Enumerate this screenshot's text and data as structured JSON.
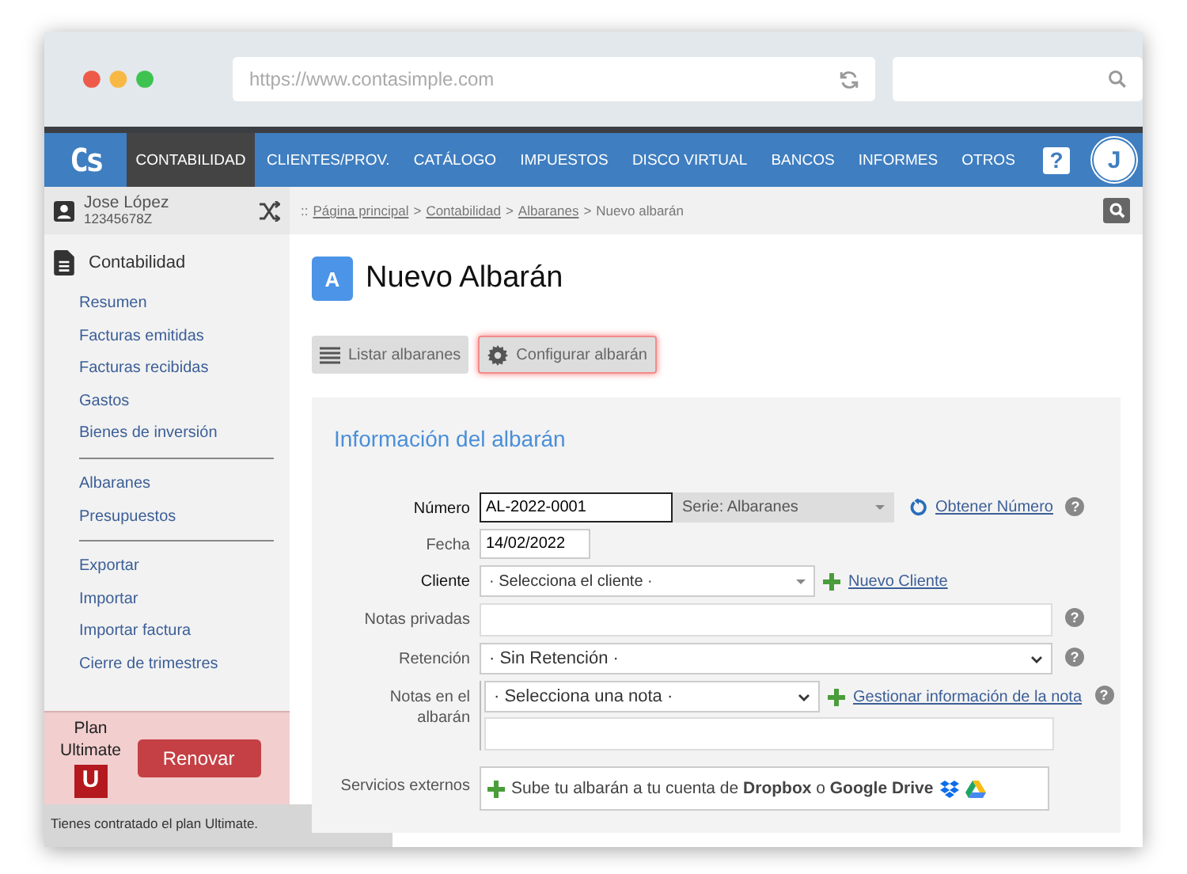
{
  "browser": {
    "url": "https://www.contasimple.com"
  },
  "nav": {
    "logo": "Cs",
    "items": [
      {
        "label": "CONTABILIDAD",
        "selected": true
      },
      {
        "label": "CLIENTES/PROV.",
        "selected": false
      },
      {
        "label": "CATÁLOGO",
        "selected": false
      },
      {
        "label": "IMPUESTOS",
        "selected": false
      },
      {
        "label": "DISCO VIRTUAL",
        "selected": false
      },
      {
        "label": "BANCOS",
        "selected": false
      },
      {
        "label": "INFORMES",
        "selected": false
      },
      {
        "label": "OTROS",
        "selected": false
      }
    ],
    "help": "?",
    "avatar": "J"
  },
  "user": {
    "name": "Jose López",
    "id": "12345678Z"
  },
  "sidebar": {
    "section": "Contabilidad",
    "groups": [
      [
        "Resumen",
        "Facturas emitidas",
        "Facturas recibidas",
        "Gastos",
        "Bienes de inversión"
      ],
      [
        "Albaranes",
        "Presupuestos"
      ],
      [
        "Exportar",
        "Importar",
        "Importar factura",
        "Cierre de trimestres"
      ]
    ]
  },
  "plan": {
    "label": "Plan",
    "name": "Ultimate",
    "badge": "U",
    "button": "Renovar",
    "note": "Tienes contratado el plan Ultimate."
  },
  "breadcrumb": [
    {
      "label": "::",
      "link": false
    },
    {
      "label": "Página principal",
      "link": true
    },
    {
      "label": ">",
      "link": false
    },
    {
      "label": "Contabilidad",
      "link": true
    },
    {
      "label": ">",
      "link": false
    },
    {
      "label": "Albaranes",
      "link": true
    },
    {
      "label": ">",
      "link": false
    },
    {
      "label": "Nuevo albarán",
      "link": false
    }
  ],
  "page": {
    "icon_letter": "A",
    "title": "Nuevo Albarán"
  },
  "toolbar": [
    {
      "kind": "list",
      "label": "Listar albaranes",
      "highlighted": false
    },
    {
      "kind": "settings",
      "label": "Configurar albarán",
      "highlighted": true
    }
  ],
  "form": {
    "title": "Información del albarán",
    "rows": [
      {
        "kind": "number",
        "label": "Número",
        "required": true,
        "value": "AL-2022-0001",
        "series": "Serie: Albaranes",
        "action": "Obtener Número",
        "help": "?"
      },
      {
        "kind": "date",
        "label": "Fecha",
        "required": false,
        "value": "14/02/2022"
      },
      {
        "kind": "client",
        "label": "Cliente",
        "required": true,
        "value": "· Selecciona el cliente ·",
        "action": "Nuevo Cliente"
      },
      {
        "kind": "textarea",
        "label": "Notas privadas",
        "required": false,
        "help": "?"
      },
      {
        "kind": "select",
        "label": "Retención",
        "required": false,
        "value": "· Sin Retención ·",
        "help": "?"
      },
      {
        "kind": "notes",
        "label": "Notas en el albarán",
        "required": false,
        "value": "· Selecciona una nota ·",
        "action": "Gestionar información de la nota",
        "help": "?"
      },
      {
        "kind": "external",
        "label": "Servicios externos",
        "required": false,
        "text": "Sube tu albarán a tu cuenta de **Dropbox** o **Google Drive**"
      }
    ]
  }
}
